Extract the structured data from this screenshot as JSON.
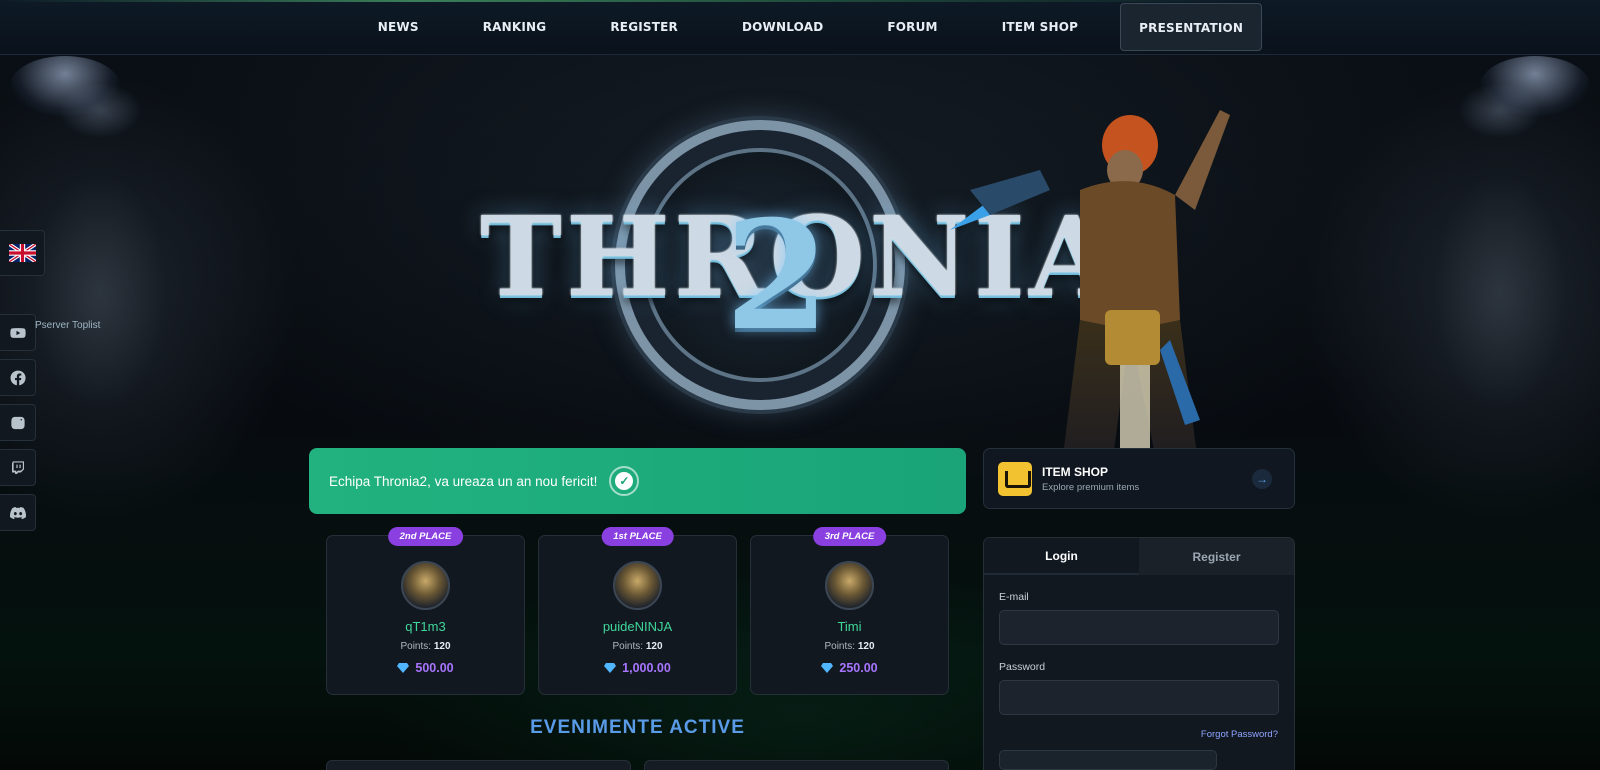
{
  "nav": {
    "items": [
      "NEWS",
      "RANKING",
      "REGISTER",
      "DOWNLOAD",
      "FORUM",
      "ITEM SHOP",
      "PRESENTATION"
    ],
    "active": "PRESENTATION"
  },
  "sidebar": {
    "language": "en",
    "toplist_label": "Pserver Toplist",
    "socials": [
      "youtube-icon",
      "facebook-icon",
      "instagram-icon",
      "twitch-icon",
      "discord-icon"
    ]
  },
  "logo": {
    "text": "THRONIA",
    "number": "2"
  },
  "announcement": {
    "text": "Echipa Thronia2, va ureaza un an nou fericit!"
  },
  "ranking": [
    {
      "place": "2nd PLACE",
      "name": "qT1m3",
      "points_label": "Points:",
      "points": "120",
      "prize": "500.00"
    },
    {
      "place": "1st PLACE",
      "name": "puideNINJA",
      "points_label": "Points:",
      "points": "120",
      "prize": "1,000.00"
    },
    {
      "place": "3rd PLACE",
      "name": "Timi",
      "points_label": "Points:",
      "points": "120",
      "prize": "250.00"
    }
  ],
  "events": {
    "title": "EVENIMENTE ACTIVE"
  },
  "shop": {
    "title": "ITEM SHOP",
    "subtitle": "Explore premium items"
  },
  "login": {
    "tabs": [
      "Login",
      "Register"
    ],
    "active_tab": "Login",
    "email_label": "E-mail",
    "email_value": "",
    "password_label": "Password",
    "password_value": "",
    "forgot": "Forgot Password?"
  },
  "colors": {
    "accent_green": "#1fae7d",
    "rank_badge": "#8a3fe0",
    "rank_name": "#3fd79a",
    "prize": "#a775ff",
    "events_title": "#5a9be8",
    "shop_icon": "#f2c230"
  }
}
